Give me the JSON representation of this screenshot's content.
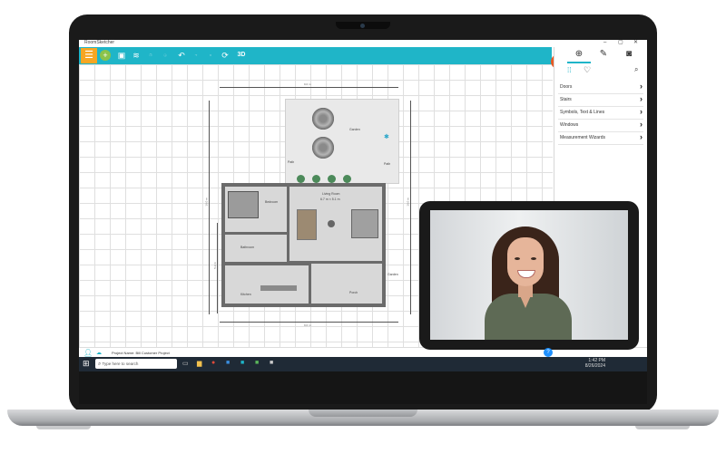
{
  "app": {
    "title": "RoomSketcher",
    "window_controls": [
      "–",
      "▢",
      "✕"
    ]
  },
  "toolbar": {
    "menu_icon": "hamburger-icon",
    "buttons": [
      {
        "name": "add-icon",
        "glyph": "+"
      },
      {
        "name": "save-icon",
        "glyph": "💾"
      },
      {
        "name": "settings-sliders-icon",
        "glyph": "≈"
      },
      {
        "name": "copy-icon",
        "glyph": "❐",
        "dim": true
      },
      {
        "name": "paste-icon",
        "glyph": "❏",
        "dim": true
      },
      {
        "name": "undo-icon",
        "glyph": "↶"
      },
      {
        "name": "redo-icon",
        "glyph": "↷",
        "dim": true
      },
      {
        "name": "delete-icon",
        "glyph": "🗑",
        "dim": true
      },
      {
        "name": "refresh-icon",
        "glyph": "⟳"
      }
    ],
    "view_3d_label": "3D"
  },
  "right_panel": {
    "tabs": [
      {
        "name": "tab-add",
        "glyph": "⊕",
        "active": true
      },
      {
        "name": "tab-edit",
        "glyph": "✎"
      },
      {
        "name": "tab-camera",
        "glyph": "📷"
      }
    ],
    "categories": [
      "Doors",
      "Stairs",
      "Symbols, Text & Lines",
      "Windows",
      "Measurement Wizards"
    ]
  },
  "floor_plan": {
    "rooms": {
      "garden": "Garden",
      "path_left": "Path",
      "path_right": "Path",
      "living_room": "Living Room",
      "living_room_size": "6.7 m × 5.1 m",
      "bathroom": "Bathroom",
      "bedroom": "Bedroom",
      "kitchen": "Kitchen",
      "porch": "Porch",
      "garden_side": "Garden"
    },
    "dimensions": {
      "top": "9.0 m",
      "bottom": "9.0 m",
      "left": "16.0 m",
      "left_inner": "5.2 m",
      "right": "16.0 m"
    }
  },
  "status_bar": {
    "project_name": "Project Name: Bill Customer Project"
  },
  "taskbar": {
    "search_placeholder": "Type here to search",
    "time": "1:42 PM",
    "date": "8/26/2024"
  },
  "colors": {
    "toolbar": "#1fb5c8",
    "menu_button": "#f6a623",
    "camera_button": "#e85a25",
    "taskbar": "#1f2a36"
  }
}
